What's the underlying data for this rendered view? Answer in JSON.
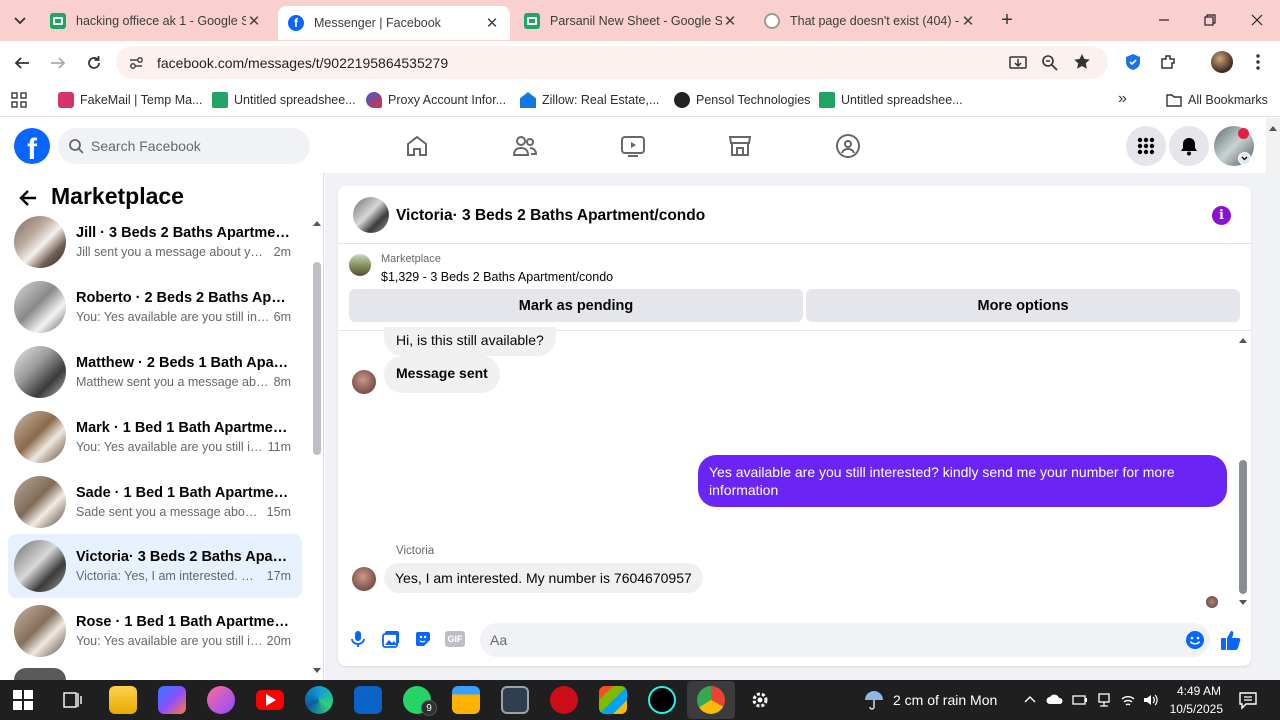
{
  "browser": {
    "tabs": [
      {
        "title": "hacking offiece ak 1 - Google Sh",
        "favicon": "sheets-icon"
      },
      {
        "title": "Messenger | Facebook",
        "favicon": "facebook-icon",
        "active": true
      },
      {
        "title": "Parsanil New Sheet - Google Sh",
        "favicon": "sheets-icon"
      },
      {
        "title": "That page doesn't exist (404) - F",
        "favicon": "globe-icon"
      }
    ],
    "url": "facebook.com/messages/t/9022195864535279",
    "bookmarks": [
      {
        "label": "FakeMail | Temp Ma..."
      },
      {
        "label": "Untitled spreadshee..."
      },
      {
        "label": "Proxy Account Infor..."
      },
      {
        "label": "Zillow: Real Estate,..."
      },
      {
        "label": "Pensol Technologies"
      },
      {
        "label": "Untitled spreadshee..."
      }
    ],
    "all_bookmarks": "All Bookmarks"
  },
  "facebook": {
    "search_placeholder": "Search Facebook"
  },
  "marketplace": {
    "title": "Marketplace",
    "conversations": [
      {
        "name": "Jill · 3 Beds 2 Baths Apartment/...",
        "preview": "Jill sent you a message about your...",
        "time": "2m"
      },
      {
        "name": "Roberto · 2 Beds 2 Baths Apart...",
        "preview": "You: Yes available are you still inter...",
        "time": "6m"
      },
      {
        "name": "Matthew · 2 Beds 1 Bath Apartm...",
        "preview": "Matthew sent you a message abo...",
        "time": "8m"
      },
      {
        "name": "Mark · 1 Bed 1 Bath Apartment/...",
        "preview": "You: Yes available are you still int...",
        "time": "11m"
      },
      {
        "name": "Sade · 1 Bed 1 Bath Apartment/c...",
        "preview": "Sade sent you a message about ...",
        "time": "15m"
      },
      {
        "name": "Victoria· 3 Beds 2 Baths Apartm...",
        "preview": "Victoria: Yes, I am interested. My ...",
        "time": "17m",
        "active": true
      },
      {
        "name": "Rose · 1 Bed 1 Bath Apartment/c...",
        "preview": "You: Yes available are you still int...",
        "time": "20m"
      }
    ]
  },
  "chat": {
    "title": "Victoria· 3 Beds 2 Baths Apartment/condo",
    "listing_source": "Marketplace",
    "listing_text": "$1,329 - 3 Beds 2 Baths Apartment/condo",
    "mark_pending": "Mark as pending",
    "more_options": "More options",
    "messages": {
      "m1": "Hi, is this still available?",
      "m2": "Message sent",
      "m3": "Yes available are you still interested? kindly send me your number for more information",
      "sender": "Victoria",
      "m4": "Yes, I am interested. My number is 7604670957"
    },
    "composer_placeholder": "Aa"
  },
  "taskbar": {
    "weather": "2 cm of rain Mon",
    "time": "4:49 AM",
    "date": "10/5/2025",
    "whatsapp_badge": "9"
  },
  "colors": {
    "fb_blue": "#0866ff",
    "outgoing_bubble": "#6a24f4",
    "tabbar_bg": "#f9d0cd",
    "active_conv_bg": "#e7f0fd"
  }
}
